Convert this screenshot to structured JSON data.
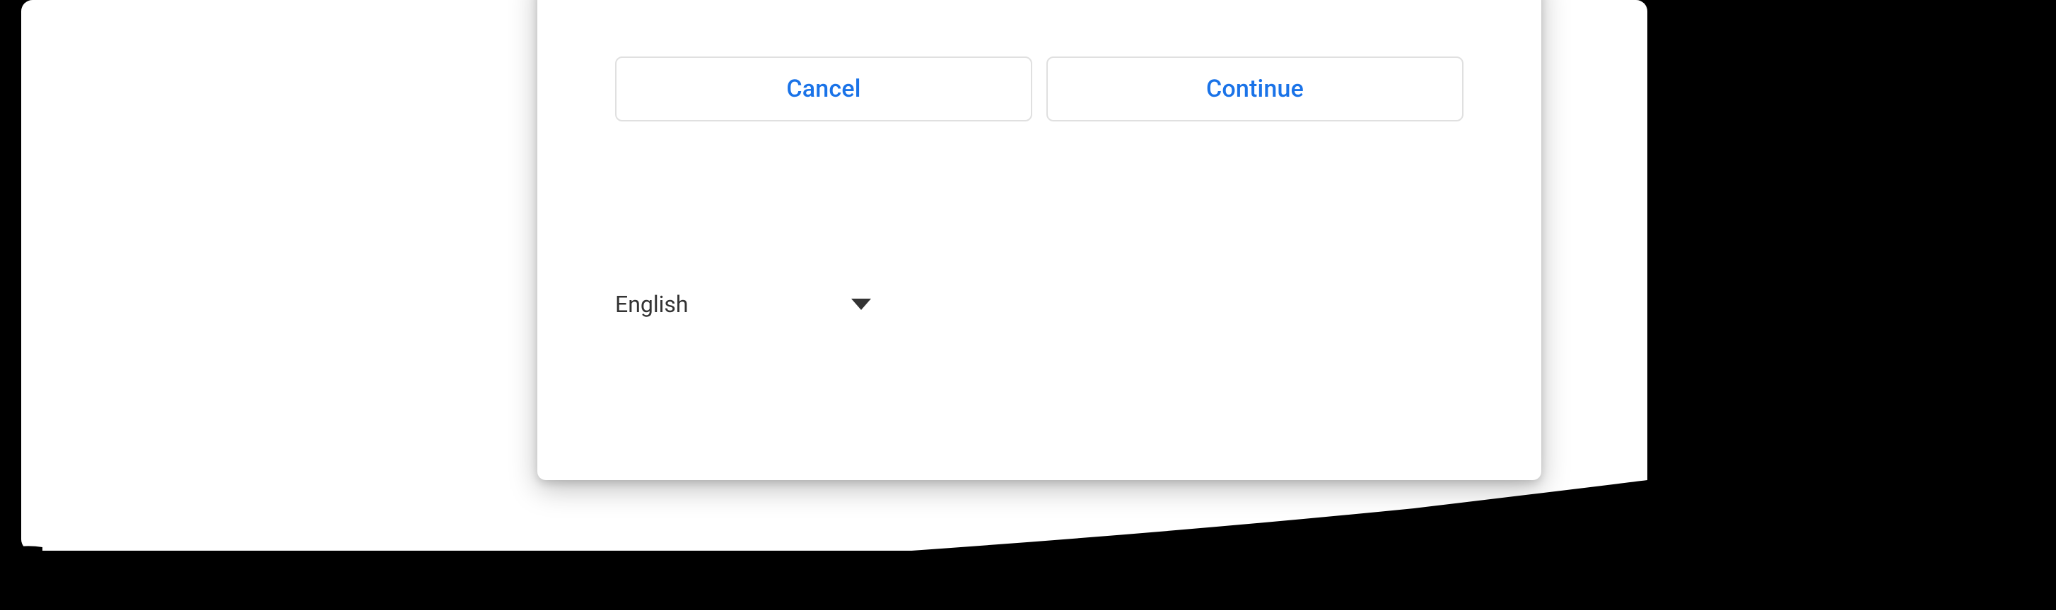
{
  "dialog": {
    "cancel_label": "Cancel",
    "continue_label": "Continue"
  },
  "language": {
    "selected": "English"
  }
}
